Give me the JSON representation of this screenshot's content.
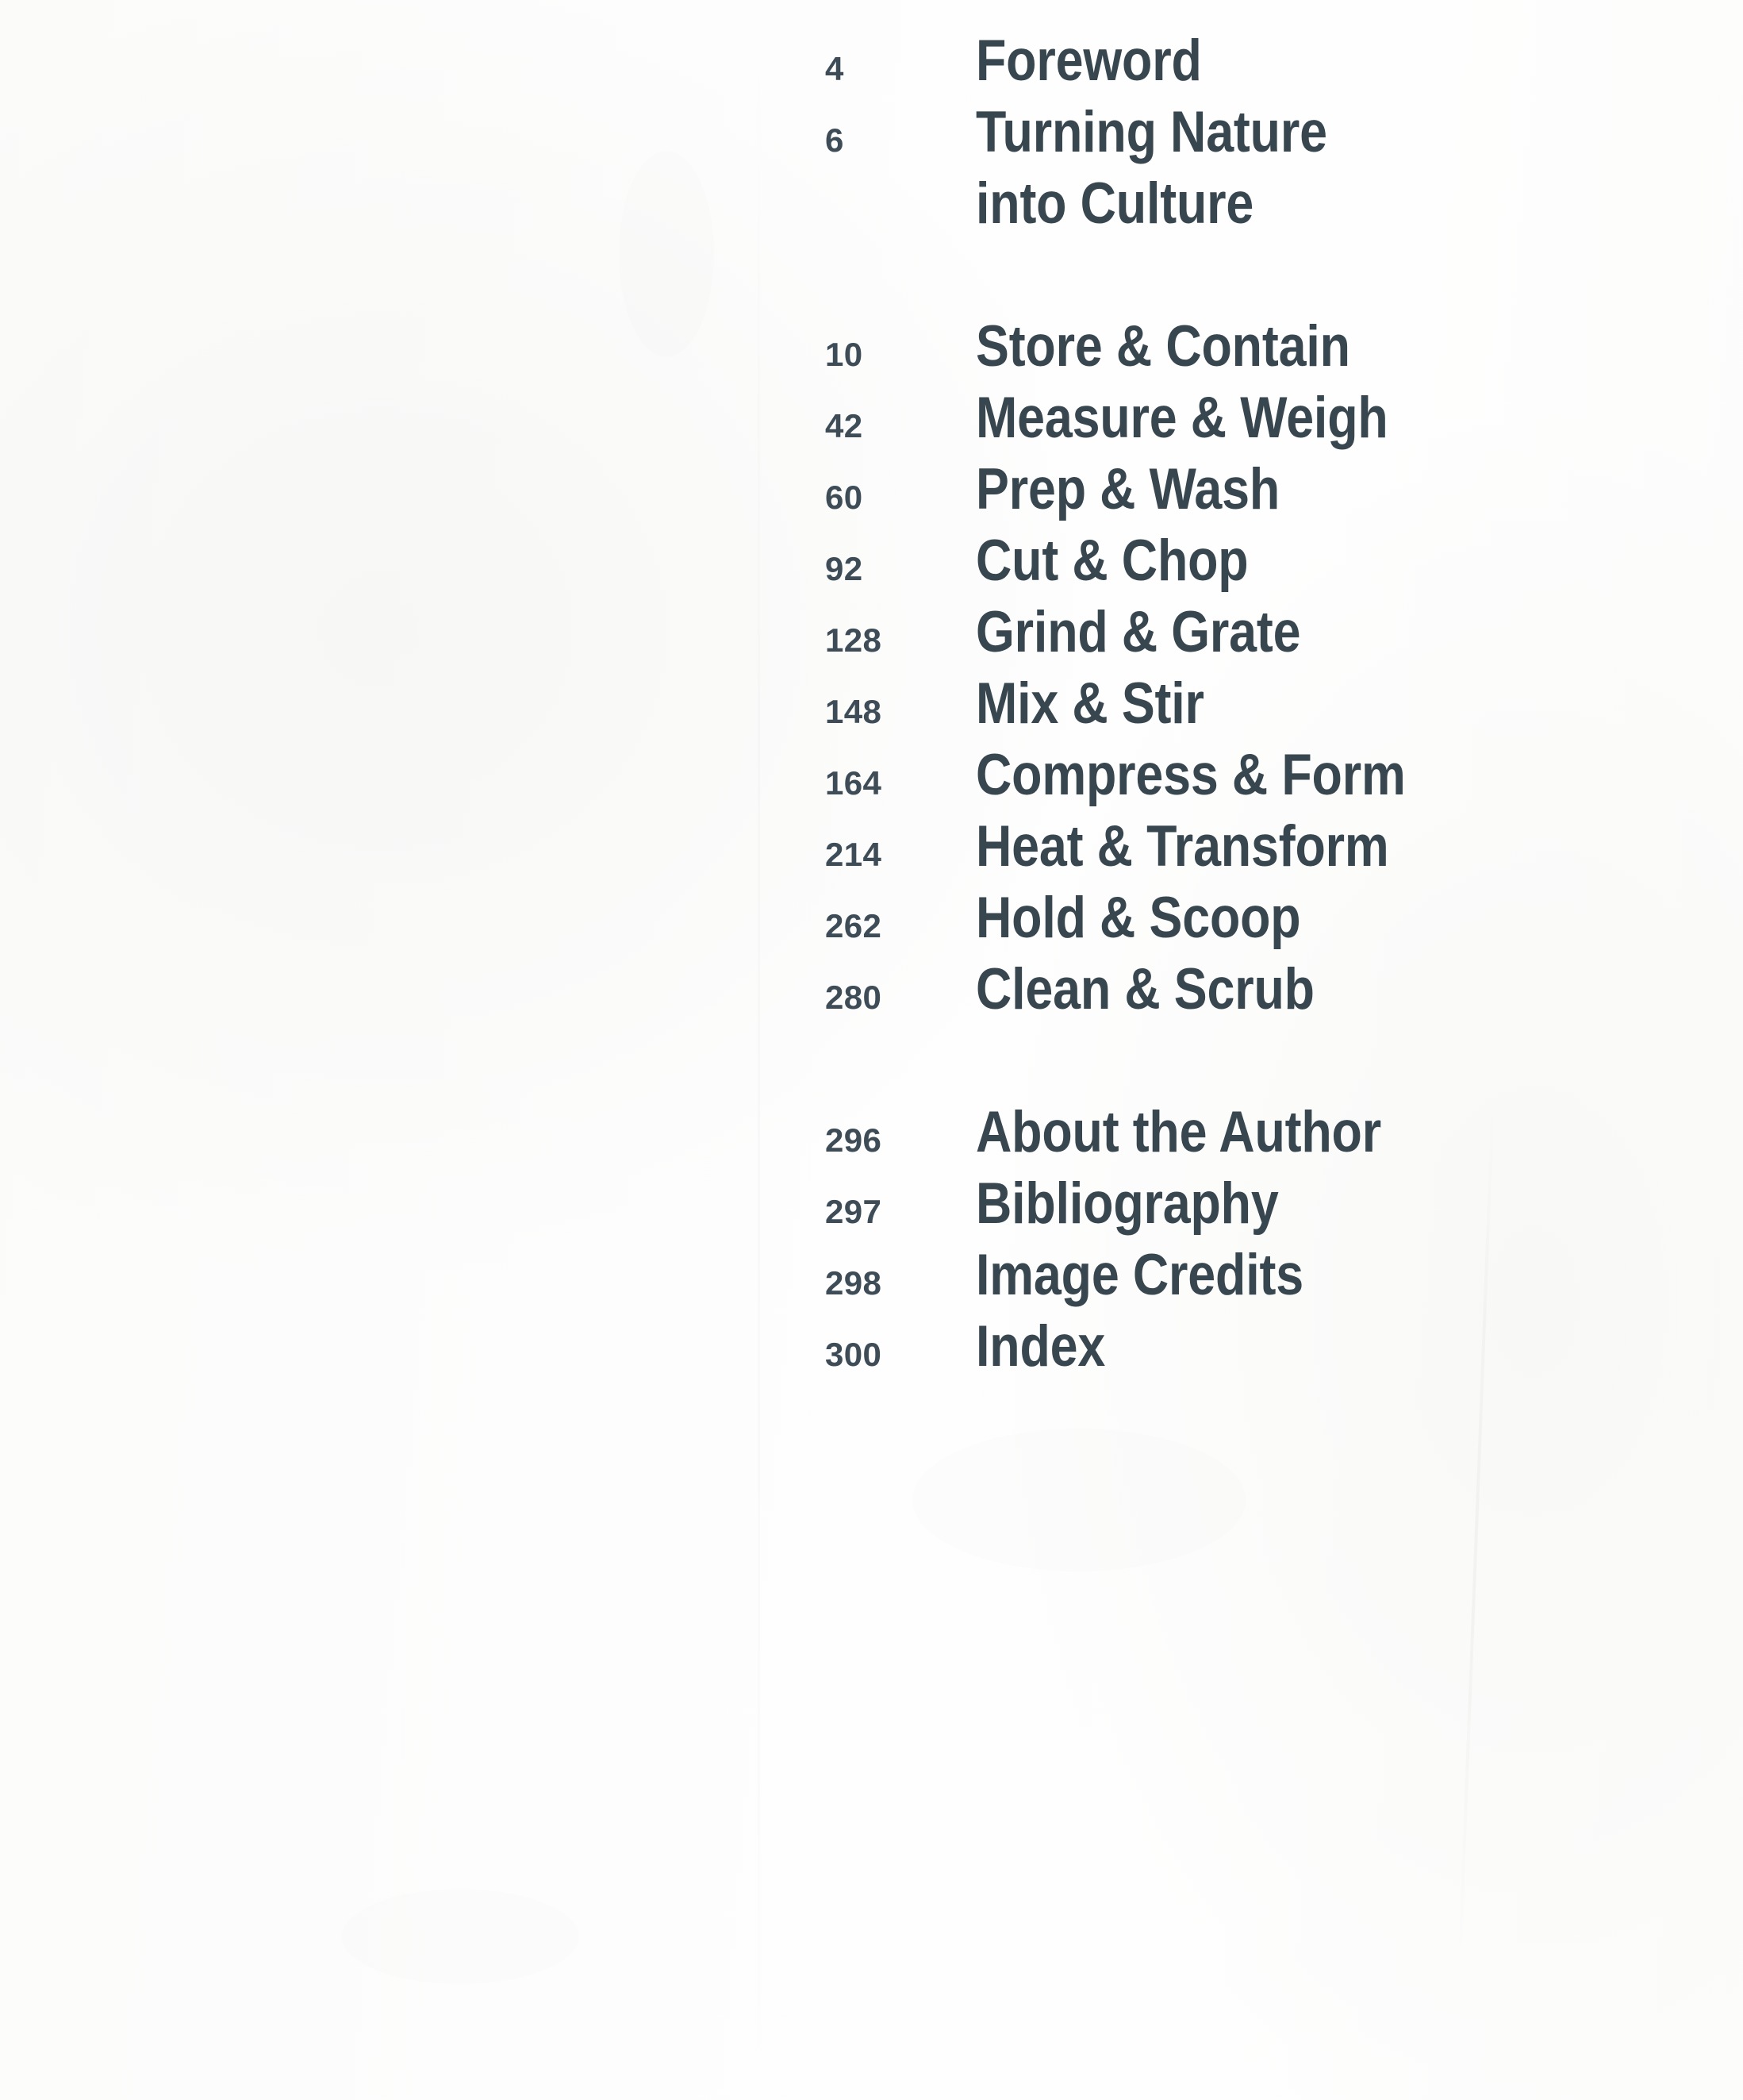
{
  "page": {
    "kind": "table-of-contents",
    "paper_color": "#fdfdfd",
    "text_color": "#38474f",
    "number_color": "#3d4c57"
  },
  "toc": {
    "blocks": [
      {
        "name": "front-matter",
        "entries": [
          {
            "page": "4",
            "title": "Foreword"
          },
          {
            "page": "6",
            "title": "Turning Nature",
            "title_line2": "into Culture"
          }
        ]
      },
      {
        "name": "chapters",
        "entries": [
          {
            "page": "10",
            "title": "Store & Contain"
          },
          {
            "page": "42",
            "title": "Measure & Weigh"
          },
          {
            "page": "60",
            "title": "Prep & Wash"
          },
          {
            "page": "92",
            "title": "Cut & Chop"
          },
          {
            "page": "128",
            "title": "Grind & Grate"
          },
          {
            "page": "148",
            "title": "Mix & Stir"
          },
          {
            "page": "164",
            "title": "Compress & Form"
          },
          {
            "page": "214",
            "title": "Heat & Transform"
          },
          {
            "page": "262",
            "title": "Hold & Scoop"
          },
          {
            "page": "280",
            "title": "Clean & Scrub"
          }
        ]
      },
      {
        "name": "back-matter",
        "entries": [
          {
            "page": "296",
            "title": "About the Author"
          },
          {
            "page": "297",
            "title": "Bibliography"
          },
          {
            "page": "298",
            "title": "Image Credits"
          },
          {
            "page": "300",
            "title": "Index"
          }
        ]
      }
    ]
  }
}
